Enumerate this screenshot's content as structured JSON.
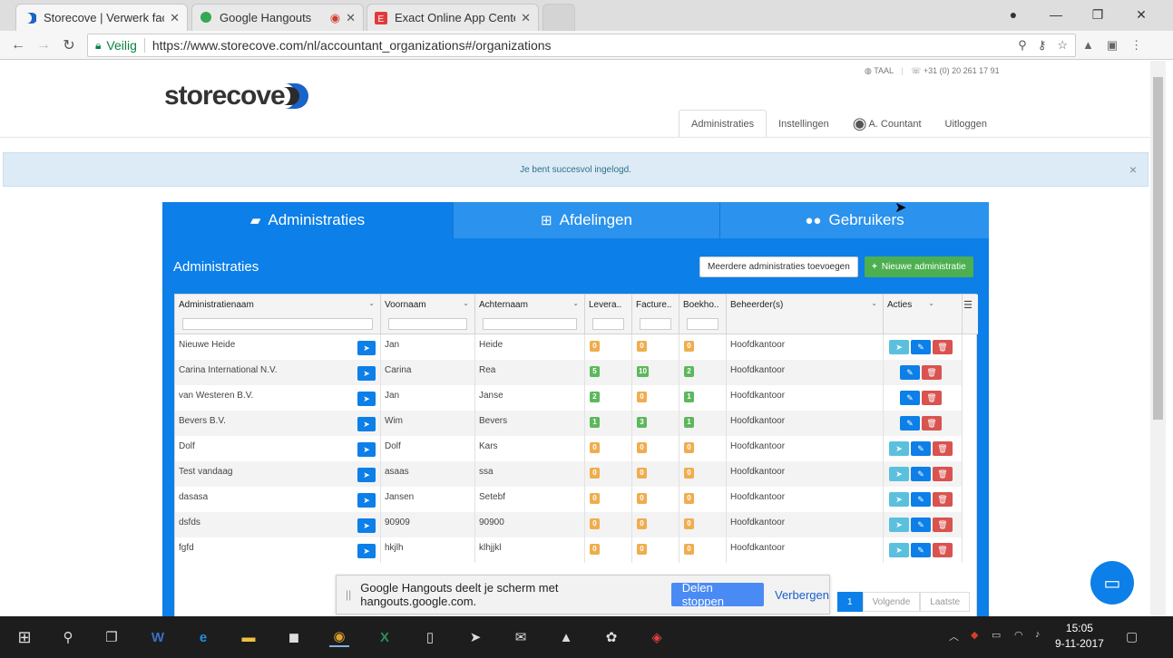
{
  "browser": {
    "tabs": [
      {
        "title": "Storecove | Verwerk factu",
        "active": true
      },
      {
        "title": "Google Hangouts",
        "active": false
      },
      {
        "title": "Exact Online App Center",
        "active": false
      }
    ],
    "secure_label": "Veilig",
    "url": "https://www.storecove.com/nl/accountant_organizations#/organizations"
  },
  "site": {
    "lang_label": "TAAL",
    "phone": "+31 (0) 20 261 17 91",
    "logo_text": "storecove",
    "nav": [
      {
        "label": "Administraties",
        "active": true
      },
      {
        "label": "Instellingen",
        "active": false
      },
      {
        "label": "A. Countant",
        "active": false
      },
      {
        "label": "Uitloggen",
        "active": false
      }
    ],
    "alert": "Je bent succesvol ingelogd.",
    "alert_close": "×"
  },
  "panel": {
    "tabs": [
      {
        "label": "Administraties",
        "icon": "briefcase-icon"
      },
      {
        "label": "Afdelingen",
        "icon": "sitemap-icon"
      },
      {
        "label": "Gebruikers",
        "icon": "users-icon"
      }
    ],
    "title": "Administraties",
    "btn_add_multiple": "Meerdere administraties toevoegen",
    "btn_new": "Nieuwe administratie",
    "btn_new_icon": "+"
  },
  "grid": {
    "columns": [
      "Administratienaam",
      "Voornaam",
      "Achternaam",
      "Levera..",
      "Facture..",
      "Boekho..",
      "Beheerder(s)",
      "Acties"
    ],
    "rows": [
      {
        "name": "Nieuwe Heide",
        "first": "Jan",
        "last": "Heide",
        "lev": "0",
        "fac": "0",
        "boek": "0",
        "lev_c": "orange",
        "fac_c": "orange",
        "boek_c": "orange",
        "beheerder": "Hoofdkantoor",
        "send": true
      },
      {
        "name": "Carina International N.V.",
        "first": "Carina",
        "last": "Rea",
        "lev": "5",
        "fac": "10",
        "boek": "2",
        "lev_c": "green",
        "fac_c": "green",
        "boek_c": "green",
        "beheerder": "Hoofdkantoor",
        "send": false
      },
      {
        "name": "van Westeren B.V.",
        "first": "Jan",
        "last": "Janse",
        "lev": "2",
        "fac": "0",
        "boek": "1",
        "lev_c": "green",
        "fac_c": "orange",
        "boek_c": "green",
        "beheerder": "Hoofdkantoor",
        "send": false
      },
      {
        "name": "Bevers B.V.",
        "first": "Wim",
        "last": "Bevers",
        "lev": "1",
        "fac": "3",
        "boek": "1",
        "lev_c": "green",
        "fac_c": "green",
        "boek_c": "green",
        "beheerder": "Hoofdkantoor",
        "send": false
      },
      {
        "name": "Dolf",
        "first": "Dolf",
        "last": "Kars",
        "lev": "0",
        "fac": "0",
        "boek": "0",
        "lev_c": "orange",
        "fac_c": "orange",
        "boek_c": "orange",
        "beheerder": "Hoofdkantoor",
        "send": true
      },
      {
        "name": "Test vandaag",
        "first": "asaas",
        "last": "ssa",
        "lev": "0",
        "fac": "0",
        "boek": "0",
        "lev_c": "orange",
        "fac_c": "orange",
        "boek_c": "orange",
        "beheerder": "Hoofdkantoor",
        "send": true
      },
      {
        "name": "dasasa",
        "first": "Jansen",
        "last": "Setebf",
        "lev": "0",
        "fac": "0",
        "boek": "0",
        "lev_c": "orange",
        "fac_c": "orange",
        "boek_c": "orange",
        "beheerder": "Hoofdkantoor",
        "send": true
      },
      {
        "name": "dsfds",
        "first": "90909",
        "last": "90900",
        "lev": "0",
        "fac": "0",
        "boek": "0",
        "lev_c": "orange",
        "fac_c": "orange",
        "boek_c": "orange",
        "beheerder": "Hoofdkantoor",
        "send": true
      },
      {
        "name": "fgfd",
        "first": "hkjlh",
        "last": "klhjjkl",
        "lev": "0",
        "fac": "0",
        "boek": "0",
        "lev_c": "orange",
        "fac_c": "orange",
        "boek_c": "orange",
        "beheerder": "Hoofdkantoor",
        "send": true
      }
    ]
  },
  "pager": {
    "current": "1",
    "next": "Volgende",
    "last": "Laatste"
  },
  "sharebar": {
    "message": "Google Hangouts deelt je scherm met hangouts.google.com.",
    "stop": "Delen stoppen",
    "hide": "Verbergen"
  },
  "taskbar": {
    "time": "15:05",
    "date": "9-11-2017"
  },
  "colors": {
    "primary": "#0c7fe8",
    "green": "#4caf50",
    "badge_orange": "#f0ad4e",
    "badge_green": "#5cb85c",
    "delete": "#d9534f"
  }
}
